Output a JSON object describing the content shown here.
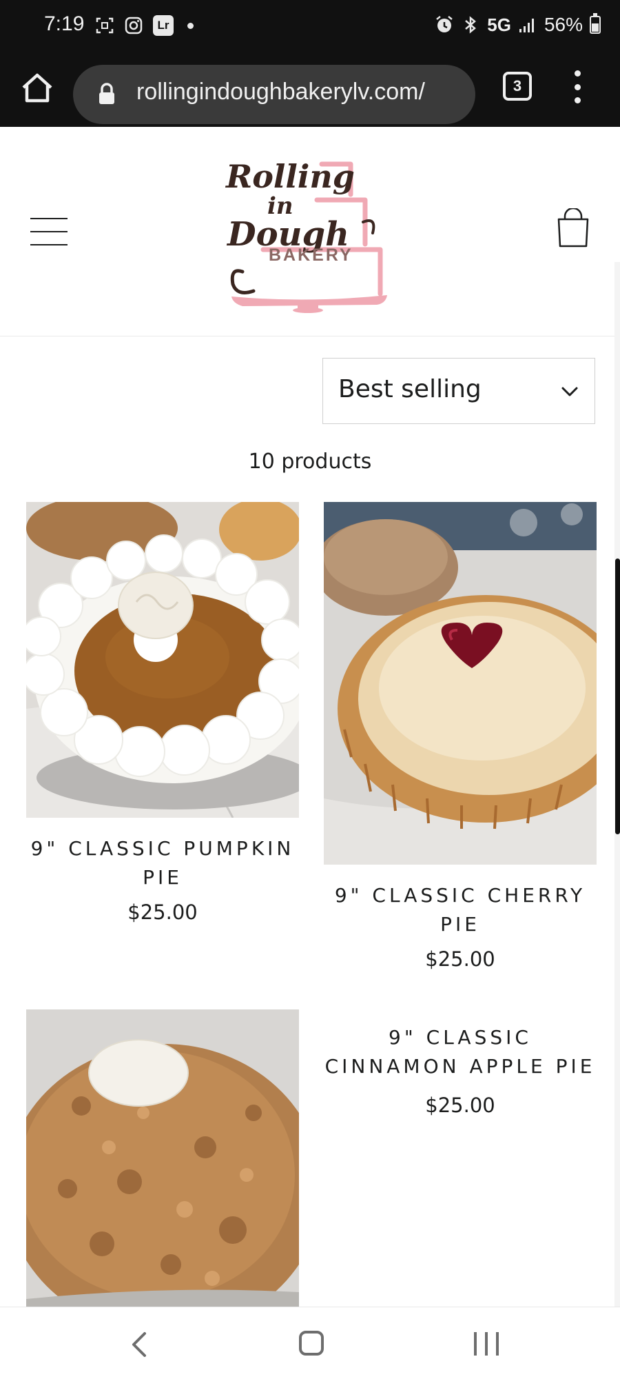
{
  "status_bar": {
    "time": "7:19",
    "network": "5G",
    "battery": "56%"
  },
  "browser": {
    "url": "rollingindoughbakerylv.com/",
    "tab_count": "3"
  },
  "header": {
    "logo_text": "BAKERY",
    "logo_script": [
      "Rolling",
      "in",
      "Dough"
    ]
  },
  "sort": {
    "selected": "Best selling"
  },
  "product_count": "10 products",
  "products": [
    {
      "title": "9\" CLASSIC PUMPKIN PIE",
      "price": "$25.00"
    },
    {
      "title": "9\" CLASSIC CHERRY PIE",
      "price": "$25.00"
    },
    {
      "title": "9\" CLASSIC CINNAMON APPLE PIE",
      "price": "$25.00"
    }
  ],
  "colors": {
    "accent_pink": "#f0a9b4",
    "logo_brown": "#3a2620",
    "text": "#1c1d1d"
  }
}
